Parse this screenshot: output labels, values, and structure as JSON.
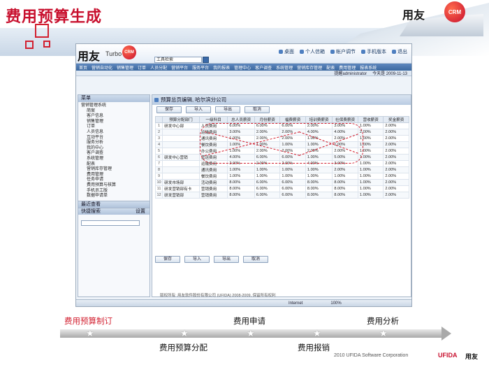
{
  "slide": {
    "title": "费用预算生成",
    "brand_cn": "用友",
    "brand_badge": "CRM",
    "copyright": "2010 UFIDA Software Corporation",
    "company_en": "UFIDA",
    "company_cn": "用友"
  },
  "app": {
    "logo_cn": "用友",
    "logo_turbo": "Turbo",
    "logo_crm": "CRM",
    "topnav": [
      "桌面",
      "个人信箱",
      "帐户调节",
      "手机版本",
      "退出"
    ],
    "search_placeholder": "工具检索",
    "menubar": [
      "首页",
      "营销自动化",
      "销售管理",
      "订单",
      "人员分配",
      "营销平台",
      "服务平台",
      "我的报表",
      "管理中心",
      "客户调查",
      "系统管理",
      "营销库存管理",
      "配表",
      "费用管理",
      "报表系统"
    ],
    "userbar": {
      "user": "提醒administrator",
      "date": "今天是 2009-11-13"
    },
    "sidebar_title": "菜单",
    "tree": [
      {
        "level": 1,
        "label": "营销管理系统"
      },
      {
        "level": 2,
        "label": "简案"
      },
      {
        "level": 2,
        "label": "客户信息"
      },
      {
        "level": 2,
        "label": "销售管理"
      },
      {
        "level": 2,
        "label": "订单"
      },
      {
        "level": 2,
        "label": "人员信息"
      },
      {
        "level": 2,
        "label": "互动平台"
      },
      {
        "level": 2,
        "label": "服务分析"
      },
      {
        "level": 2,
        "label": "我的中心"
      },
      {
        "level": 2,
        "label": "客户调查"
      },
      {
        "level": 2,
        "label": "系统管理"
      },
      {
        "level": 2,
        "label": "配表"
      },
      {
        "level": 2,
        "label": "营销库存管理"
      },
      {
        "level": 2,
        "label": "费用管理"
      },
      {
        "level": 2,
        "label": "任务申请"
      },
      {
        "level": 2,
        "label": "费用预算与核算"
      },
      {
        "level": 2,
        "label": "手机员工版"
      },
      {
        "level": 2,
        "label": "数据申请单"
      }
    ],
    "side_section_1": "最近查看",
    "side_section_2": "快捷搜索",
    "side_section_2_link": "设置",
    "main_title": "预算总页编辑, 哈尔滨分公司",
    "buttons": [
      "保存",
      "导入",
      "导出",
      "取消"
    ],
    "columns": [
      "",
      "预算分配部门",
      "一级科目",
      "总人员薪资",
      "月份薪资",
      "福费薪资",
      "培训费薪资",
      "社保费薪资",
      "营收薪资",
      "奖金薪资"
    ],
    "rows": [
      [
        "1",
        "研发中心部",
        "人员费用",
        "6.00%",
        "6.00%",
        "6.00%",
        "2.00%",
        "3.00%",
        "1.00%",
        "2.00%"
      ],
      [
        "2",
        "",
        "运输费用",
        "3.00%",
        "2.00%",
        "2.00%",
        "4.00%",
        "4.00%",
        "2.00%",
        "2.00%"
      ],
      [
        "3",
        "",
        "通讯费用",
        "1.00%",
        "2.00%",
        "2.00%",
        "1.00%",
        "2.00%",
        "1.00%",
        "2.00%"
      ],
      [
        "4",
        "",
        "餐饮费用",
        "1.00%",
        "1.00%",
        "1.00%",
        "1.00%",
        "1.00%",
        "1.00%",
        "2.00%"
      ],
      [
        "5",
        "",
        "办公费用",
        "1.00%",
        "2.00%",
        "2.00%",
        "2.00%",
        "2.00%",
        "1.00%",
        "2.00%"
      ],
      [
        "6",
        "研发中心营销",
        "营运费用",
        "4.00%",
        "6.00%",
        "6.00%",
        "1.00%",
        "5.00%",
        "1.00%",
        "2.00%"
      ],
      [
        "7",
        "",
        "运输费用",
        "2.00%",
        "2.00%",
        "2.00%",
        "4.00%",
        "3.00%",
        "1.00%",
        "2.00%"
      ],
      [
        "8",
        "",
        "通讯费用",
        "1.00%",
        "1.00%",
        "1.00%",
        "1.00%",
        "2.00%",
        "1.00%",
        "2.00%"
      ],
      [
        "9",
        "",
        "餐饮费用",
        "1.00%",
        "1.00%",
        "1.00%",
        "1.00%",
        "1.00%",
        "1.00%",
        "2.00%"
      ],
      [
        "10",
        "研发市场部",
        "活动费用",
        "8.00%",
        "6.00%",
        "6.00%",
        "8.00%",
        "8.00%",
        "1.00%",
        "2.00%"
      ],
      [
        "11",
        "研发营销部有卡",
        "营销费用",
        "8.00%",
        "6.00%",
        "6.00%",
        "8.00%",
        "8.00%",
        "1.00%",
        "2.00%"
      ],
      [
        "12",
        "研发营销部",
        "营销费用",
        "8.00%",
        "6.00%",
        "6.00%",
        "8.00%",
        "8.00%",
        "1.00%",
        "2.00%"
      ]
    ],
    "footer_text": "版权所有: 用友软件股份有限公司 (UFIDA) 2008-2009, 保留所有权利",
    "status_zone": "Internet",
    "status_zoom": "100%"
  },
  "timeline": {
    "steps": [
      {
        "label": "费用预算制订",
        "active": true
      },
      {
        "label": "费用预算分配",
        "active": false
      },
      {
        "label": "费用申请",
        "active": false
      },
      {
        "label": "费用报销",
        "active": false
      },
      {
        "label": "费用分析",
        "active": false
      }
    ]
  }
}
